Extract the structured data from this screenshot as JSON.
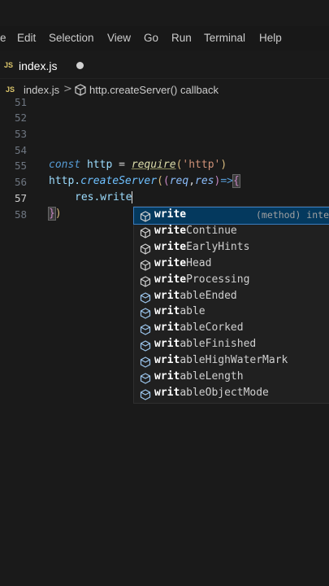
{
  "menubar": {
    "items": [
      "e",
      "Edit",
      "Selection",
      "View",
      "Go",
      "Run",
      "Terminal",
      "Help"
    ]
  },
  "tab": {
    "icon": "JS",
    "filename": "index.js",
    "modified": true
  },
  "breadcrumb": {
    "icon": "JS",
    "file": "index.js",
    "separator": ">",
    "symbol_icon": "method-cube-icon",
    "symbol": "http.createServer() callback"
  },
  "editor": {
    "line_numbers": [
      "51",
      "52",
      "53",
      "54",
      "55",
      "56",
      "57",
      "58"
    ],
    "active_line": "57",
    "lines": {
      "l55": {
        "kw": "const",
        "var": " http",
        "eq": " = ",
        "fn": "require",
        "p1": "(",
        "str": "'http'",
        "p2": ")"
      },
      "l56": {
        "obj": "http.",
        "fn": "createServer",
        "p1": "(",
        "p2": "(",
        "a": "req",
        "c": ",",
        "b": "res",
        "p3": ")",
        "arrow": "=>",
        "br": "{"
      },
      "l57": {
        "text": "res.write"
      },
      "l58": {
        "br": "}",
        "p": ")"
      }
    }
  },
  "suggestions": {
    "selected_detail": "(method) inter",
    "items": [
      {
        "match": "write",
        "rest": ""
      },
      {
        "match": "write",
        "rest": "Continue"
      },
      {
        "match": "write",
        "rest": "EarlyHints"
      },
      {
        "match": "write",
        "rest": "Head"
      },
      {
        "match": "write",
        "rest": "Processing"
      },
      {
        "match": "writ",
        "rest": "ableEnded"
      },
      {
        "match": "writ",
        "rest": "able"
      },
      {
        "match": "writ",
        "rest": "ableCorked"
      },
      {
        "match": "writ",
        "rest": "ableFinished"
      },
      {
        "match": "writ",
        "rest": "ableHighWaterMark"
      },
      {
        "match": "writ",
        "rest": "ableLength"
      },
      {
        "match": "writ",
        "rest": "ableObjectMode"
      }
    ]
  }
}
